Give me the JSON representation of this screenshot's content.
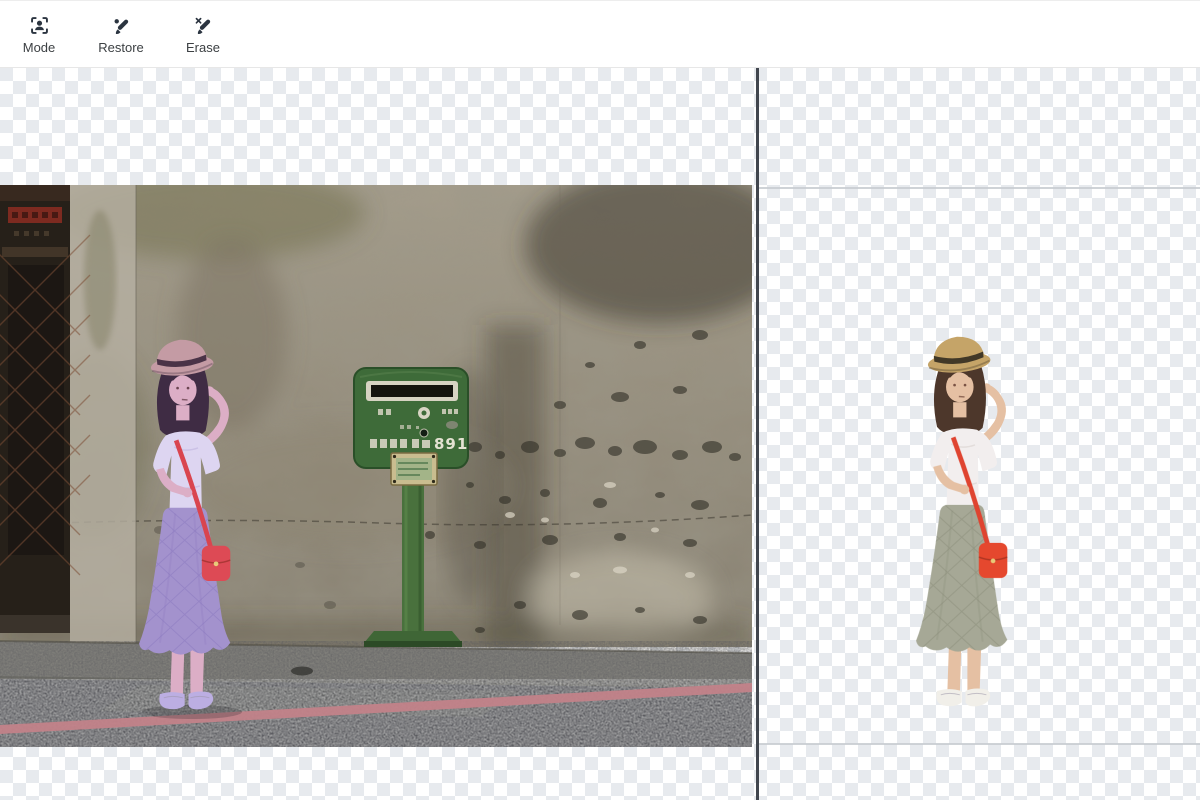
{
  "app": {
    "name": "background-remover-editor"
  },
  "toolbar": {
    "tools": [
      {
        "id": "mode",
        "label": "Mode",
        "icon": "person-frame-icon"
      },
      {
        "id": "restore",
        "label": "Restore",
        "icon": "brush-restore-icon"
      },
      {
        "id": "erase",
        "label": "Erase",
        "icon": "brush-erase-icon"
      }
    ]
  },
  "comparison": {
    "left_panel": {
      "name": "original-photo-with-subject-mask"
    },
    "right_panel": {
      "name": "cutout-subject-on-transparency"
    },
    "mailbox_number": "891"
  },
  "colors": {
    "toolbar-icon": "#2b3440",
    "toolbar-label": "#3c4043",
    "divider": "#41464e",
    "checker-light": "#ffffff",
    "checker-dark": "#e7eaee",
    "mask-tint": "#a392cd",
    "bag-red": "#e5482e",
    "mailbox-green": "#3e6b39",
    "road-stripe": "#c28289",
    "bound-line": "#c7cbd0"
  }
}
